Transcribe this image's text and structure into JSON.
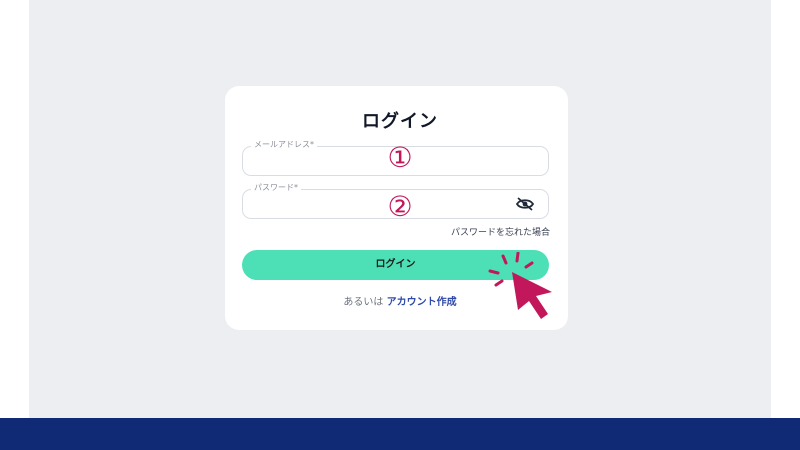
{
  "login": {
    "title": "ログイン",
    "email_label": "メールアドレス*",
    "password_label": "パスワード*",
    "forgot_password": "パスワードを忘れた場合",
    "login_button": "ログイン",
    "alt_prefix": "あるいは",
    "create_account": "アカウント作成"
  },
  "annotations": {
    "step1": "①",
    "step2": "②"
  },
  "icons": {
    "password_toggle": "eye-slash-icon",
    "cursor": "pointer-click-icon"
  },
  "colors": {
    "background": "#eceef1",
    "bottom_bar": "#112a76",
    "button": "#4de0b7",
    "annotation": "#c2185b",
    "link": "#2f4aa8"
  }
}
